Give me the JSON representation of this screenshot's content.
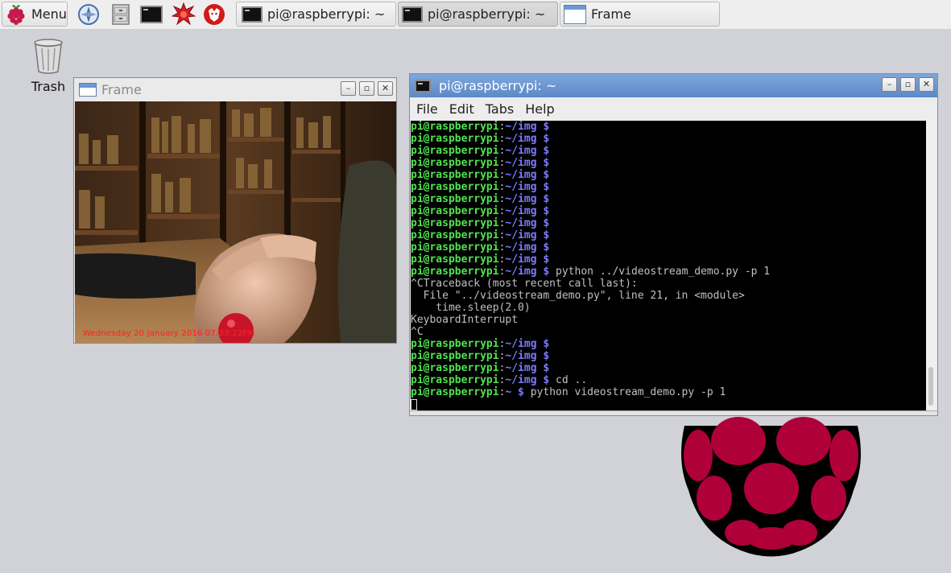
{
  "taskbar": {
    "menu_label": "Menu",
    "launchers": [
      {
        "icon": "web-browser-icon"
      },
      {
        "icon": "file-manager-icon"
      },
      {
        "icon": "terminal-icon"
      },
      {
        "icon": "mathematica-icon"
      },
      {
        "icon": "wolfram-icon"
      }
    ],
    "tasks": [
      {
        "label": "pi@raspberrypi: ~",
        "icon": "terminal-icon",
        "active": false
      },
      {
        "label": "pi@raspberrypi: ~",
        "icon": "terminal-icon",
        "active": true
      },
      {
        "label": "Frame",
        "icon": "window-icon",
        "active": false
      }
    ]
  },
  "desktop": {
    "trash_label": "Trash"
  },
  "frame_window": {
    "title": "Frame",
    "timestamp_overlay": "Wednesday 20 January 2016 07:33:22PM"
  },
  "terminal_window": {
    "title": "pi@raspberrypi: ~",
    "menu": [
      "File",
      "Edit",
      "Tabs",
      "Help"
    ],
    "lines": [
      {
        "user": "pi@raspberrypi",
        "sep": ":",
        "path": "~/img $",
        "cmd": ""
      },
      {
        "user": "pi@raspberrypi",
        "sep": ":",
        "path": "~/img $",
        "cmd": ""
      },
      {
        "user": "pi@raspberrypi",
        "sep": ":",
        "path": "~/img $",
        "cmd": ""
      },
      {
        "user": "pi@raspberrypi",
        "sep": ":",
        "path": "~/img $",
        "cmd": ""
      },
      {
        "user": "pi@raspberrypi",
        "sep": ":",
        "path": "~/img $",
        "cmd": ""
      },
      {
        "user": "pi@raspberrypi",
        "sep": ":",
        "path": "~/img $",
        "cmd": ""
      },
      {
        "user": "pi@raspberrypi",
        "sep": ":",
        "path": "~/img $",
        "cmd": ""
      },
      {
        "user": "pi@raspberrypi",
        "sep": ":",
        "path": "~/img $",
        "cmd": ""
      },
      {
        "user": "pi@raspberrypi",
        "sep": ":",
        "path": "~/img $",
        "cmd": ""
      },
      {
        "user": "pi@raspberrypi",
        "sep": ":",
        "path": "~/img $",
        "cmd": ""
      },
      {
        "user": "pi@raspberrypi",
        "sep": ":",
        "path": "~/img $",
        "cmd": ""
      },
      {
        "user": "pi@raspberrypi",
        "sep": ":",
        "path": "~/img $",
        "cmd": ""
      },
      {
        "user": "pi@raspberrypi",
        "sep": ":",
        "path": "~/img $",
        "cmd": " python ../videostream_demo.py -p 1"
      },
      {
        "text": "^CTraceback (most recent call last):"
      },
      {
        "text": "  File \"../videostream_demo.py\", line 21, in <module>"
      },
      {
        "text": "    time.sleep(2.0)"
      },
      {
        "text": "KeyboardInterrupt"
      },
      {
        "text": "^C"
      },
      {
        "user": "pi@raspberrypi",
        "sep": ":",
        "path": "~/img $",
        "cmd": ""
      },
      {
        "user": "pi@raspberrypi",
        "sep": ":",
        "path": "~/img $",
        "cmd": ""
      },
      {
        "user": "pi@raspberrypi",
        "sep": ":",
        "path": "~/img $",
        "cmd": ""
      },
      {
        "user": "pi@raspberrypi",
        "sep": ":",
        "path": "~/img $",
        "cmd": " cd .."
      },
      {
        "user": "pi@raspberrypi",
        "sep": ":",
        "path": "~ $",
        "cmd": " python videostream_demo.py -p 1"
      }
    ]
  },
  "colors": {
    "prompt_user": "#4ee64e",
    "prompt_path": "#7b7bff",
    "raspberry": "#b0003a",
    "desktop_bg": "#d1d1d8"
  }
}
